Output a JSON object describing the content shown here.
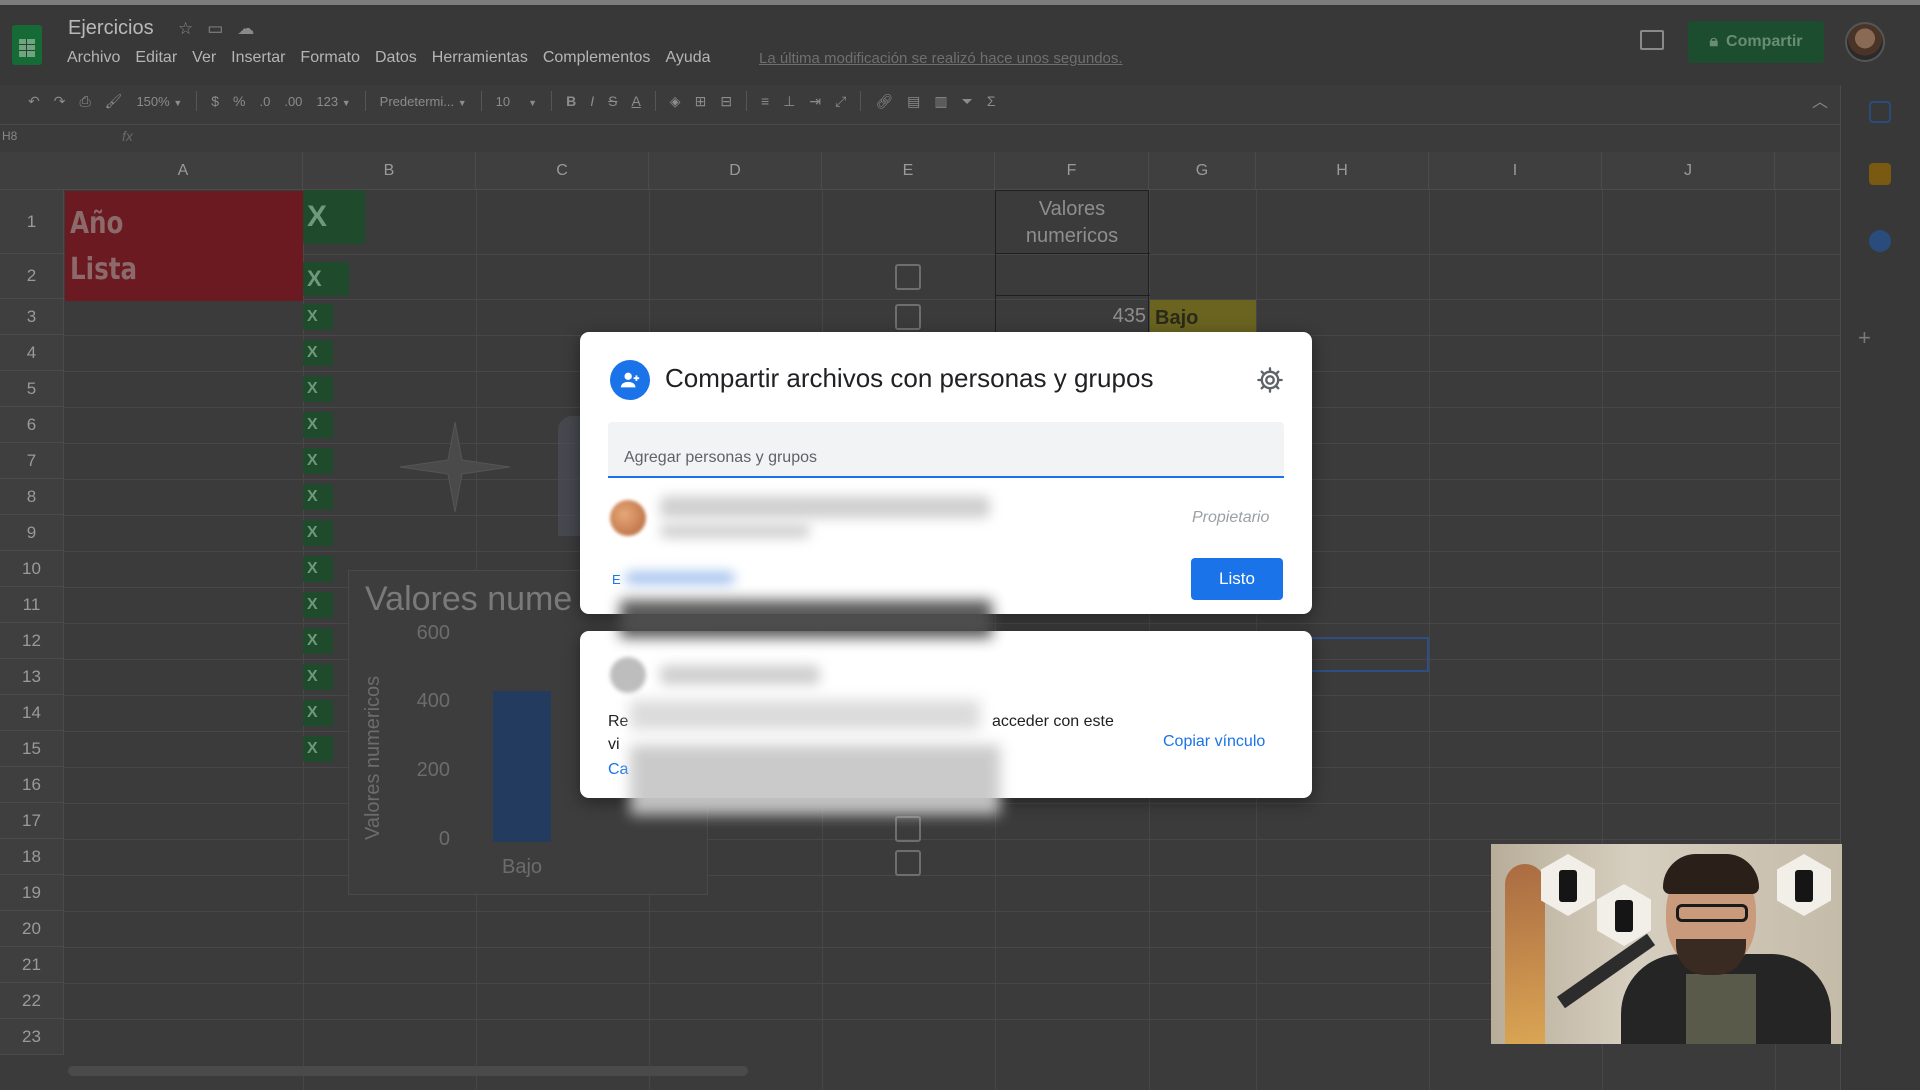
{
  "app": {
    "title": "Ejercicios",
    "menu": [
      "Archivo",
      "Editar",
      "Ver",
      "Insertar",
      "Formato",
      "Datos",
      "Herramientas",
      "Complementos",
      "Ayuda"
    ],
    "last_edit": "La última modificación se realizó hace unos segundos.",
    "share_label": "Compartir"
  },
  "toolbar": {
    "zoom": "150%",
    "currency": "$",
    "percent": "%",
    "decimal_less": ".0",
    "decimal_more": ".00",
    "number_format": "123",
    "font": "Predetermi...",
    "font_size": "10",
    "bold": "B",
    "italic": "I",
    "strike": "S",
    "text_color": "A",
    "sum": "Σ"
  },
  "formula_bar": {
    "cell_ref": "H8",
    "fx": "fx"
  },
  "grid": {
    "columns": [
      "A",
      "B",
      "C",
      "D",
      "E",
      "F",
      "G",
      "H",
      "I",
      "J"
    ],
    "rows": [
      "1",
      "2",
      "3",
      "4",
      "5",
      "6",
      "7",
      "8",
      "9",
      "10",
      "11",
      "12",
      "13",
      "14",
      "15",
      "16",
      "17",
      "18",
      "19",
      "20",
      "21",
      "22",
      "23"
    ],
    "a1": "Año",
    "a2": "Lista",
    "excel_icon_text": "X",
    "f_header": "Valores numericos",
    "f3": "435",
    "g3": "Bajo",
    "f11_partial": "..."
  },
  "chart_data": {
    "type": "bar",
    "title": "Valores nume",
    "ylabel": "Valores numericos",
    "ylim": [
      0,
      600
    ],
    "yticks": [
      "600",
      "400",
      "200",
      "0"
    ],
    "categories": [
      "Bajo"
    ],
    "values": [
      435
    ]
  },
  "share_dialog": {
    "title": "Compartir archivos con personas y grupos",
    "input_placeholder": "Agregar personas y grupos",
    "owner_role": "Propietario",
    "done_label": "Listo",
    "send_feedback": "E"
  },
  "link_dialog": {
    "desc_start": "Re",
    "desc_end": "acceder con este",
    "desc_line2": "vi",
    "change_link": "Ca",
    "copy_label": "Copiar vínculo"
  },
  "colors": {
    "accent": "#1a73e8",
    "share_green": "#1e8e3e",
    "cell_red": "#cc0000",
    "cell_yellow": "#f1c232"
  }
}
